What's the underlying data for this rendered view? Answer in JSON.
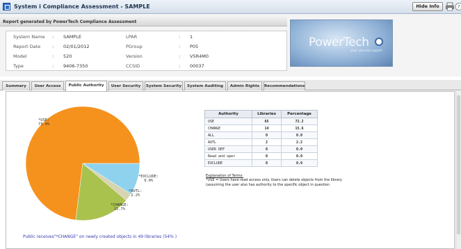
{
  "window": {
    "title": "System i Compliance Assessment - SAMPLE",
    "hide_info": "Hide Info"
  },
  "report": {
    "generated_by": "Report generated by PowerTech Compliance Assessment",
    "fields": [
      {
        "label": "System Name",
        "value": "SAMPLE"
      },
      {
        "label": "Report Date",
        "value": "02/01/2012"
      },
      {
        "label": "Model",
        "value": "520"
      },
      {
        "label": "Type",
        "value": "9406-7350"
      },
      {
        "label": "LPAR",
        "value": "1"
      },
      {
        "label": "PGroup",
        "value": "P05"
      },
      {
        "label": "Version",
        "value": "V5R4M0"
      },
      {
        "label": "CCSID",
        "value": "00037"
      }
    ],
    "colon": ":"
  },
  "logo": {
    "name": "PowerTech",
    "tagline": "your security expert"
  },
  "tabs": [
    {
      "label": "Summary",
      "active": false
    },
    {
      "label": "User Access",
      "active": false
    },
    {
      "label": "Public Authority",
      "active": true
    },
    {
      "label": "User Security",
      "active": false
    },
    {
      "label": "System Security",
      "active": false
    },
    {
      "label": "System Auditing",
      "active": false
    },
    {
      "label": "Admin Rights",
      "active": false
    },
    {
      "label": "Recommendations",
      "active": false
    }
  ],
  "chart_data": {
    "type": "pie",
    "slices": [
      {
        "label": "*USE:",
        "value": 73.0,
        "color": "#f5921e"
      },
      {
        "label": "*CHANGE:",
        "value": 15.7,
        "color": "#a9c24d"
      },
      {
        "label": "*AUTL:",
        "value": 2.2,
        "color": "#d8d3b0"
      },
      {
        "label": "*EXCLUDE:",
        "value": 9.0,
        "color": "#8fd2ee"
      }
    ],
    "pie_labels": [
      "*USE:\n73.0%",
      "*EXCLUDE:\n9.0%",
      "*AUTL:\n2.2%",
      "*CHANGE:\n15.7%"
    ]
  },
  "table": {
    "headers": [
      "Authority",
      "Libraries",
      "Percentage"
    ],
    "rows": [
      [
        "USE",
        "65",
        "72.2"
      ],
      [
        "CHANGE",
        "14",
        "15.6"
      ],
      [
        "ALL",
        "0",
        "0.0"
      ],
      [
        "AUTL",
        "2",
        "2.2"
      ],
      [
        "USER DEF",
        "0",
        "0.0"
      ],
      [
        "Read and oper",
        "0",
        "0.0"
      ],
      [
        "EXCLUDE",
        "8",
        "8.9"
      ]
    ]
  },
  "explanation": {
    "title": "Explanation of Terms:",
    "text": "*USE = Users have read access only. Users can delete objects from the library (assuming the user also has authority to the specific object in question"
  },
  "footer": {
    "note": "Public receives\"*CHANGE\" on newly created objects in 49 libraries (54% )"
  }
}
